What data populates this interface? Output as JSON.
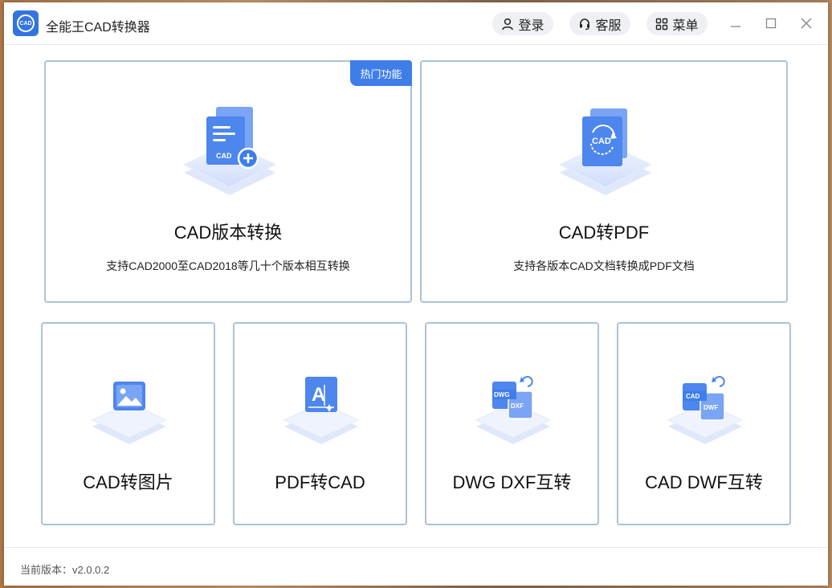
{
  "window": {
    "title": "全能王CAD转换器",
    "logo_text": "CAD"
  },
  "header": {
    "login_label": "登录",
    "service_label": "客服",
    "menu_label": "菜单"
  },
  "features_main": [
    {
      "title": "CAD版本转换",
      "desc": "支持CAD2000至CAD2018等几十个版本相互转换",
      "badge": "热门功能",
      "icon": "cad-version-icon"
    },
    {
      "title": "CAD转PDF",
      "desc": "支持各版本CAD文档转换成PDF文档",
      "icon": "cad-to-pdf-icon"
    }
  ],
  "features_small": [
    {
      "title": "CAD转图片",
      "icon": "cad-to-image-icon"
    },
    {
      "title": "PDF转CAD",
      "icon": "pdf-to-cad-icon"
    },
    {
      "title": "DWG DXF互转",
      "icon": "dwg-dxf-icon",
      "tag_a": "DWG",
      "tag_b": "DXF"
    },
    {
      "title": "CAD DWF互转",
      "icon": "cad-dwf-icon",
      "tag_a": "CAD",
      "tag_b": "DWF"
    }
  ],
  "footer": {
    "version": "当前版本：v2.0.0.2"
  },
  "colors": {
    "accent": "#3f7ee8",
    "card_border": "#a9c3d9",
    "icon_blue": "#4d86ec"
  }
}
